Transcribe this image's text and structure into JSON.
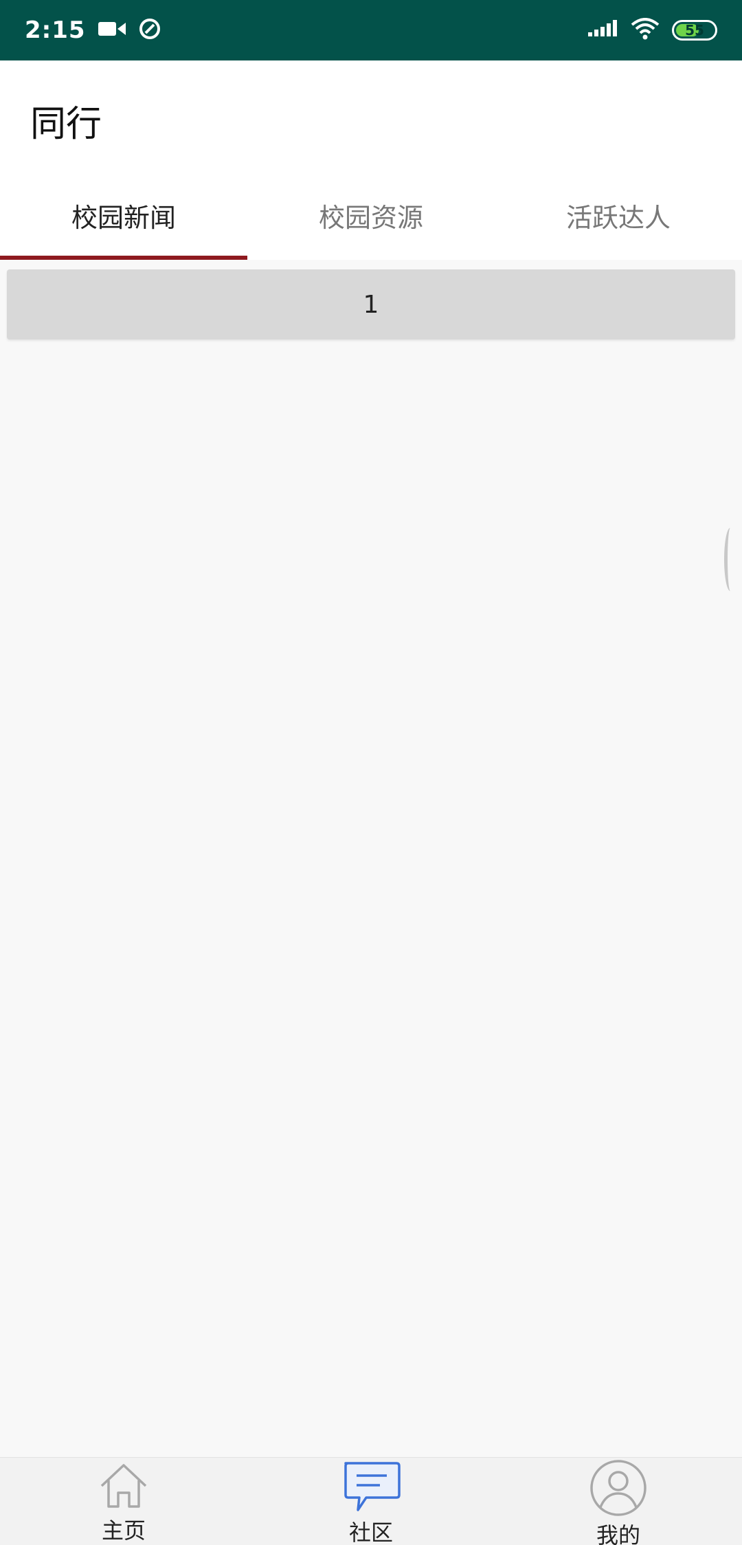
{
  "status_bar": {
    "time": "2:15",
    "battery": "55",
    "icons": [
      "video-camera-icon",
      "data-saver-icon",
      "signal-icon",
      "wifi-icon",
      "battery-icon"
    ],
    "colors": {
      "background": "#03524a",
      "battery_fill": "#6fd34a"
    }
  },
  "header": {
    "title": "同行"
  },
  "tabs": [
    {
      "label": "校园新闻",
      "active": true
    },
    {
      "label": "校园资源",
      "active": false
    },
    {
      "label": "活跃达人",
      "active": false
    }
  ],
  "tab_indicator_color": "#8e1a1f",
  "content": {
    "items": [
      {
        "text": "1"
      }
    ]
  },
  "bottom_nav": {
    "items": [
      {
        "label": "主页",
        "icon": "home-icon",
        "active": false
      },
      {
        "label": "社区",
        "icon": "chat-icon",
        "active": true
      },
      {
        "label": "我的",
        "icon": "profile-icon",
        "active": false
      }
    ],
    "active_color": "#3d73d9"
  }
}
